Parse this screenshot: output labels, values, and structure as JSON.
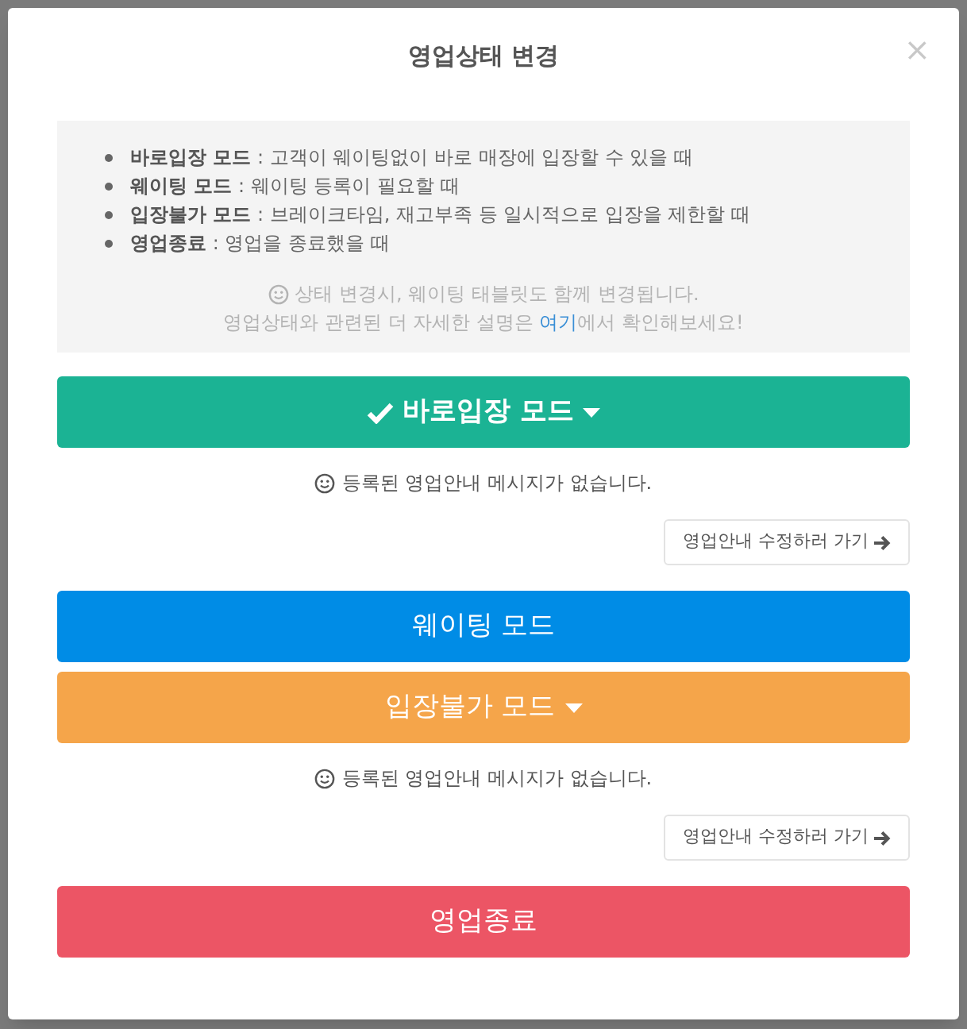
{
  "modal": {
    "title": "영업상태 변경",
    "close": "×"
  },
  "info": {
    "items": [
      {
        "term": "바로입장 모드",
        "desc": " : 고객이 웨이팅없이 바로 매장에 입장할 수 있을 때"
      },
      {
        "term": "웨이팅 모드",
        "desc": " : 웨이팅 등록이 필요할 때"
      },
      {
        "term": "입장불가 모드",
        "desc": " : 브레이크타임, 재고부족 등 일시적으로 입장을 제한할 때"
      },
      {
        "term": "영업종료",
        "desc": " : 영업을 종료했을 때"
      }
    ],
    "note": "상태 변경시, 웨이팅 태블릿도 함께 변경됩니다.",
    "detail_before": "영업상태와 관련된 더 자세한 설명은 ",
    "detail_link": "여기",
    "detail_after": "에서 확인해보세요!"
  },
  "modes": [
    {
      "label": "바로입장 모드",
      "color": "#1bb394",
      "selected": true,
      "dropdown": true,
      "notice": {
        "message": "등록된 영업안내 메시지가 없습니다.",
        "link": "영업안내 수정하러 가기"
      }
    },
    {
      "label": "웨이팅 모드",
      "color": "#008ce6",
      "selected": false,
      "dropdown": false
    },
    {
      "label": "입장불가 모드",
      "color": "#f5a54a",
      "selected": false,
      "dropdown": true,
      "notice": {
        "message": "등록된 영업안내 메시지가 없습니다.",
        "link": "영업안내 수정하러 가기"
      }
    },
    {
      "label": "영업종료",
      "color": "#ec5565",
      "selected": false,
      "dropdown": false
    }
  ]
}
